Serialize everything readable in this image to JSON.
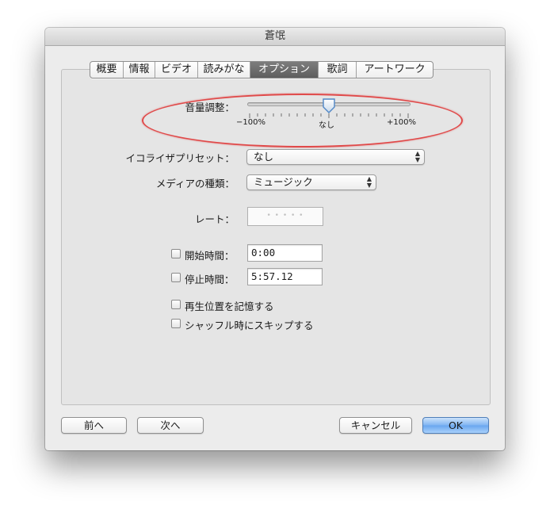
{
  "window": {
    "title": "蒼氓"
  },
  "tabs": [
    {
      "label": "概要",
      "active": false
    },
    {
      "label": "情報",
      "active": false
    },
    {
      "label": "ビデオ",
      "active": false
    },
    {
      "label": "読みがな",
      "active": false
    },
    {
      "label": "オプション",
      "active": true
    },
    {
      "label": "歌詞",
      "active": false
    },
    {
      "label": "アートワーク",
      "active": false
    }
  ],
  "volume": {
    "label": "音量調整：",
    "min_label": "−100%",
    "center_label": "なし",
    "max_label": "+100%",
    "value_fraction": 0.5
  },
  "equalizer": {
    "label": "イコライザプリセット：",
    "value": "なし"
  },
  "media_kind": {
    "label": "メディアの種類：",
    "value": "ミュージック"
  },
  "rating": {
    "label": "レート：",
    "stars": "• • • • •"
  },
  "start_time": {
    "label": "開始時間：",
    "value": "0:00",
    "checked": false
  },
  "stop_time": {
    "label": "停止時間：",
    "value": "5:57.12",
    "checked": false
  },
  "options": {
    "remember_position": {
      "label": "再生位置を記憶する",
      "checked": false
    },
    "skip_shuffle": {
      "label": "シャッフル時にスキップする",
      "checked": false
    }
  },
  "buttons": {
    "previous": "前へ",
    "next": "次へ",
    "cancel": "キャンセル",
    "ok": "OK"
  },
  "colors": {
    "annotation": "#e04a4a",
    "default_button": "#7fb4f2",
    "active_tab": "#6a6a6a"
  }
}
